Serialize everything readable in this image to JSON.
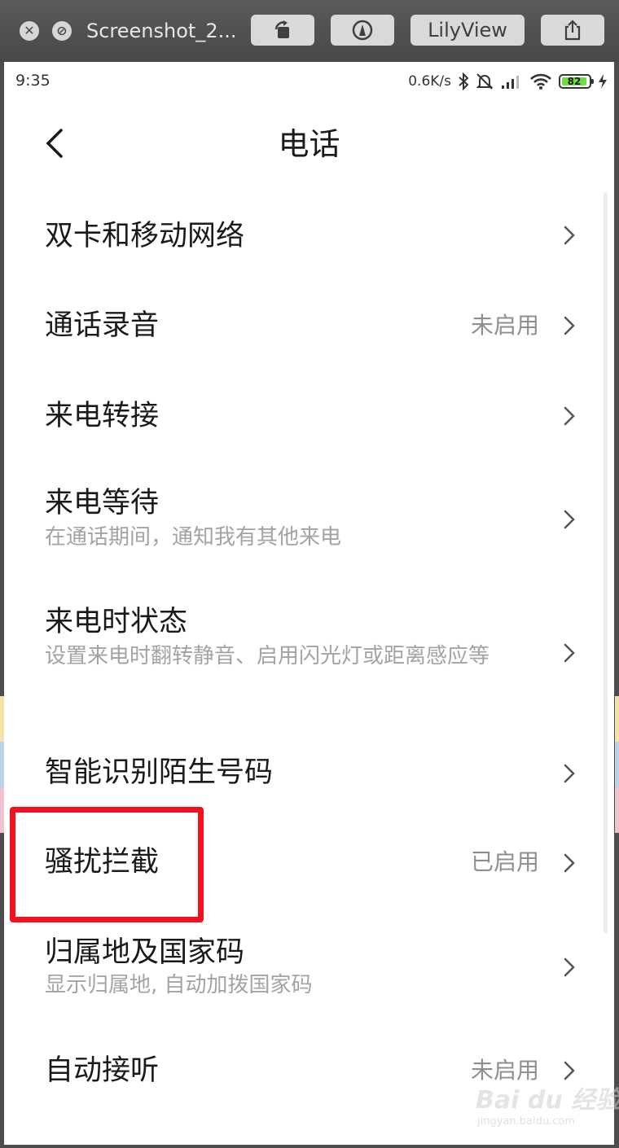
{
  "viewer": {
    "title": "Screenshot_2...",
    "lilyview_label": "LilyView"
  },
  "status_bar": {
    "time": "9:35",
    "network_speed": "0.6K/s",
    "battery_level": "82"
  },
  "header": {
    "title": "电话"
  },
  "settings": [
    {
      "title": "双卡和移动网络"
    },
    {
      "title": "通话录音",
      "value": "未启用"
    },
    {
      "title": "来电转接"
    },
    {
      "title": "来电等待",
      "subtitle": "在通话期间，通知我有其他来电"
    },
    {
      "title": "来电时状态",
      "subtitle": "设置来电时翻转静音、启用闪光灯或距离感应等"
    },
    {
      "title": "智能识别陌生号码"
    },
    {
      "title": "骚扰拦截",
      "value": "已启用"
    },
    {
      "title": "归属地及国家码",
      "subtitle": "显示归属地, 自动加拨国家码"
    },
    {
      "title": "自动接听",
      "value": "未启用"
    }
  ],
  "watermark": {
    "main": "Bai du 经验",
    "sub": "jingyan.baidu.com"
  },
  "colors": {
    "highlight": "#f2111e",
    "battery_fill": "#6fdc3f"
  }
}
